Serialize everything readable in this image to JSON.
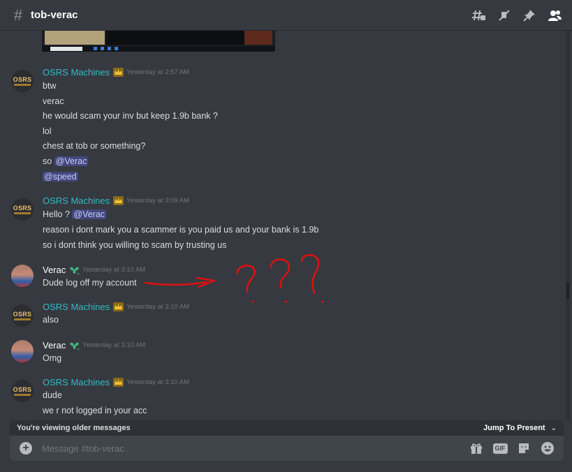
{
  "header": {
    "channel_name": "tob-verac",
    "icons": [
      "threads-icon",
      "mute-icon",
      "pin-icon",
      "members-icon"
    ]
  },
  "messages": [
    {
      "author": "OSRS Machines",
      "author_color": "#2fbcc8",
      "badge": "crown-icon",
      "timestamp": "Yesterday at 2:57 AM",
      "lines": [
        "btw",
        "verac",
        "he would scam your inv but keep 1.9b bank ?",
        "lol",
        "chest at tob or something?"
      ],
      "mention_line_1": {
        "prefix": "so ",
        "mention": "@Verac"
      },
      "mention_line_2": {
        "mention": "@speed"
      }
    },
    {
      "author": "OSRS Machines",
      "author_color": "#2fbcc8",
      "badge": "crown-icon",
      "timestamp": "Yesterday at 3:09 AM",
      "mention_line": {
        "prefix": "Hello ? ",
        "mention": "@Verac"
      },
      "lines": [
        "reason i dont mark you a scammer is you paid us and your bank is 1.9b",
        "so i dont think you willing to scam by trusting us"
      ]
    },
    {
      "author": "Verac",
      "author_color": "#ffffff",
      "badge": "leaf-icon",
      "timestamp": "Yesterday at 3:10 AM",
      "lines": [
        "Dude log off my account"
      ]
    },
    {
      "author": "OSRS Machines",
      "author_color": "#2fbcc8",
      "badge": "crown-icon",
      "timestamp": "Yesterday at 3:10 AM",
      "lines": [
        "also"
      ]
    },
    {
      "author": "Verac",
      "author_color": "#ffffff",
      "badge": "leaf-icon",
      "timestamp": "Yesterday at 3:10 AM",
      "lines": [
        "Omg"
      ]
    },
    {
      "author": "OSRS Machines",
      "author_color": "#2fbcc8",
      "badge": "crown-icon",
      "timestamp": "Yesterday at 3:10 AM",
      "lines": [
        "dude",
        "we r not logged in your acc"
      ]
    }
  ],
  "avatars": {
    "osrs_text": "OSRS"
  },
  "annotation": {
    "text": "???",
    "color": "#e01010"
  },
  "older_bar": {
    "text": "You're viewing older messages",
    "jump_label": "Jump To Present"
  },
  "composer": {
    "placeholder": "Message #tob-verac",
    "gif_label": "GIF",
    "icons": [
      "add-icon",
      "gift-icon",
      "gif-icon",
      "sticker-icon",
      "emoji-icon"
    ]
  },
  "colors": {
    "background": "#36393f",
    "mention_bg": "#4a4f8a",
    "username_osrs": "#2fbcc8",
    "timestamp": "#72767d"
  }
}
